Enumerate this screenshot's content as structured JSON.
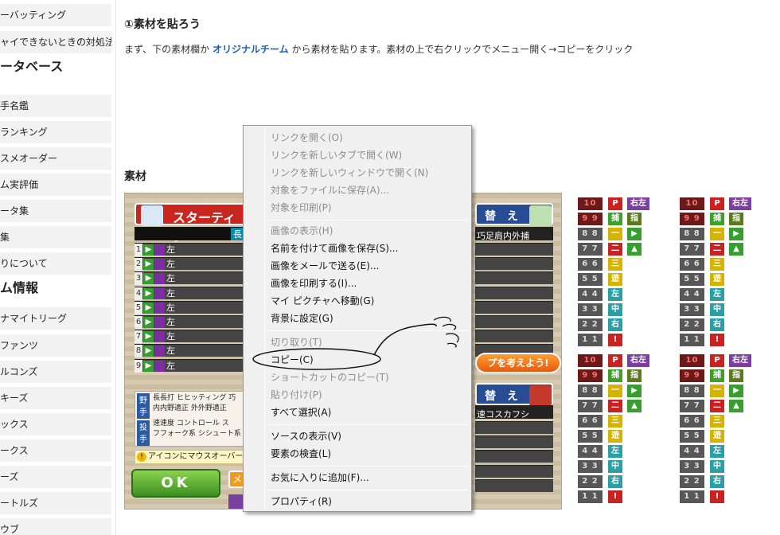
{
  "sidebar": {
    "top_links": [
      "ーバッティング",
      "ャイできないときの対処法"
    ],
    "database_heading": "ータベース",
    "database_links": [
      "手名鑑",
      "ランキング",
      "スメオーダー",
      "ム実評価",
      "ータ集",
      "集",
      "りについて"
    ],
    "team_heading": "ム情報",
    "team_links": [
      "ナマイトリーグ",
      "ファンツ",
      "ルコンズ",
      "キーズ",
      "ックス",
      "ークス",
      "ーズ",
      "ートルズ",
      "ウブ"
    ]
  },
  "article": {
    "section_title": "①素材を貼ろう",
    "intro_before": "まず、下の素材欄か",
    "intro_link": "オリジナルチーム",
    "intro_after": "から素材を貼ります。素材の上で右クリックでメニュー開く→コピーをクリック",
    "material_label": "素材"
  },
  "game": {
    "banner_left": "スターティン",
    "banner_right": "替　え",
    "banner_right2": "替　え",
    "tag_long": "長",
    "right_head": "巧足肩内外捕",
    "right_head2": "速コスカフシ",
    "lineup": [
      {
        "num": "1",
        "pos": "左"
      },
      {
        "num": "2",
        "pos": "左"
      },
      {
        "num": "3",
        "pos": "左"
      },
      {
        "num": "4",
        "pos": "左"
      },
      {
        "num": "5",
        "pos": "左"
      },
      {
        "num": "6",
        "pos": "左"
      },
      {
        "num": "7",
        "pos": "左"
      },
      {
        "num": "8",
        "pos": "左"
      },
      {
        "num": "9",
        "pos": "左"
      }
    ],
    "legend": {
      "side1": "野手",
      "side2": "投手",
      "rows": [
        "長長打 ヒヒッティング 巧",
        "内内野適正 外外野適正",
        "速速度 コントロール ス",
        "フフォーク系 シシュート系"
      ]
    },
    "note": "アイコンにマウスオーバー",
    "ok_label": "OK",
    "orange_pill": "プを考えよう!",
    "orange_square": "メ"
  },
  "sprites": {
    "numbers": [
      "10 10",
      "9 9",
      "8 8",
      "7 7",
      "6 6",
      "5 5",
      "4 4",
      "3 3",
      "2 2",
      "1 1"
    ],
    "col_a": [
      "P",
      "捕",
      "一",
      "二",
      "三",
      "遊",
      "左",
      "中",
      "右",
      "!"
    ],
    "col_b": [
      "右左両",
      "指",
      "▶",
      "▲",
      "",
      "",
      "",
      "",
      "",
      ""
    ]
  },
  "context_menu": {
    "items": [
      {
        "label": "リンクを開く(O)",
        "disabled": true
      },
      {
        "label": "リンクを新しいタブで開く(W)",
        "disabled": true
      },
      {
        "label": "リンクを新しいウィンドウで開く(N)",
        "disabled": true
      },
      {
        "label": "対象をファイルに保存(A)...",
        "disabled": true
      },
      {
        "label": "対象を印刷(P)",
        "disabled": true
      },
      {
        "label": "画像の表示(H)",
        "disabled": true
      },
      {
        "label": "名前を付けて画像を保存(S)...",
        "disabled": false
      },
      {
        "label": "画像をメールで送る(E)...",
        "disabled": false
      },
      {
        "label": "画像を印刷する(I)...",
        "disabled": false
      },
      {
        "label": "マイ ピクチャへ移動(G)",
        "disabled": false
      },
      {
        "label": "背景に設定(G)",
        "disabled": false
      },
      {
        "label": "切り取り(T)",
        "disabled": true
      },
      {
        "label": "コピー(C)",
        "disabled": false
      },
      {
        "label": "ショートカットのコピー(T)",
        "disabled": true
      },
      {
        "label": "貼り付け(P)",
        "disabled": true
      },
      {
        "label": "すべて選択(A)",
        "disabled": false
      },
      {
        "label": "ソースの表示(V)",
        "disabled": false
      },
      {
        "label": "要素の検査(L)",
        "disabled": false
      },
      {
        "label": "お気に入りに追加(F)...",
        "disabled": false
      },
      {
        "label": "プロパティ(R)",
        "disabled": false
      }
    ]
  },
  "colors": {
    "link": "#1a5fb4",
    "menu_bg": "#f0f0f0",
    "disabled_text": "#8d8d8d"
  }
}
